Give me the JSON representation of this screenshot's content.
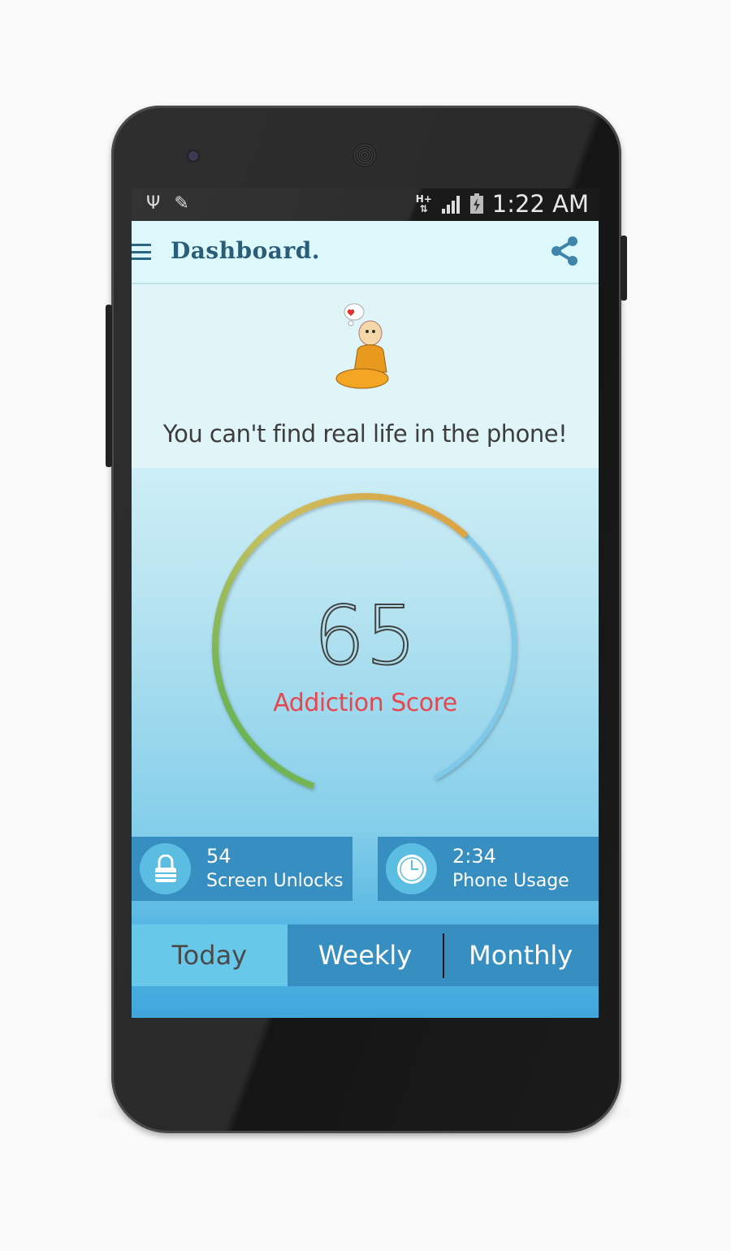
{
  "status_bar": {
    "time": "1:22 AM",
    "network": "H+",
    "left_icons": [
      "usb-icon",
      "pencil-icon"
    ],
    "right_icons": [
      "data-arrows-icon",
      "signal-icon",
      "battery-charging-icon"
    ]
  },
  "app_bar": {
    "title": "Dashboard.",
    "menu_icon": "hamburger-icon",
    "action_icon": "share-icon"
  },
  "quote": "You can't find real life in the phone!",
  "gauge": {
    "score": "65",
    "label": "Addiction Score",
    "fill_fraction": 0.65,
    "colors": {
      "start": "#4caf50",
      "mid": "#c8c060",
      "end": "#e0a040",
      "track": "#7ec8ea"
    }
  },
  "stats": [
    {
      "value": "54",
      "label": "Screen Unlocks",
      "icon": "lock-icon"
    },
    {
      "value": "2:34",
      "label": "Phone Usage",
      "icon": "clock-icon"
    }
  ],
  "tabs": [
    {
      "label": "Today",
      "active": true
    },
    {
      "label": "Weekly",
      "active": false
    },
    {
      "label": "Monthly",
      "active": false
    }
  ]
}
